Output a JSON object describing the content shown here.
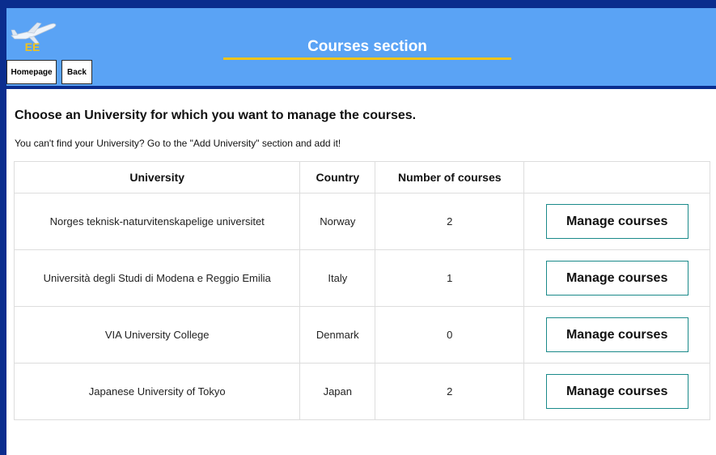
{
  "header": {
    "title": "Courses section",
    "logo_text": "EE",
    "nav": {
      "home_label": "Homepage",
      "back_label": "Back"
    }
  },
  "colors": {
    "header_bg": "#5aa3f5",
    "frame_bg": "#0a2d8e",
    "title_underline": "#f0c419",
    "button_border": "#1a8a8a"
  },
  "main": {
    "heading": "Choose an University for which you want to manage the courses.",
    "subtext": "You can't find your University? Go to the \"Add University\" section and add it!",
    "table": {
      "columns": [
        "University",
        "Country",
        "Number of courses",
        ""
      ],
      "rows": [
        {
          "university": "Norges teknisk-naturvitenskapelige universitet",
          "country": "Norway",
          "courses": "2",
          "action": "Manage courses"
        },
        {
          "university": "Università degli Studi di Modena e Reggio Emilia",
          "country": "Italy",
          "courses": "1",
          "action": "Manage courses"
        },
        {
          "university": "VIA University College",
          "country": "Denmark",
          "courses": "0",
          "action": "Manage courses"
        },
        {
          "university": "Japanese University of Tokyo",
          "country": "Japan",
          "courses": "2",
          "action": "Manage courses"
        }
      ]
    }
  }
}
